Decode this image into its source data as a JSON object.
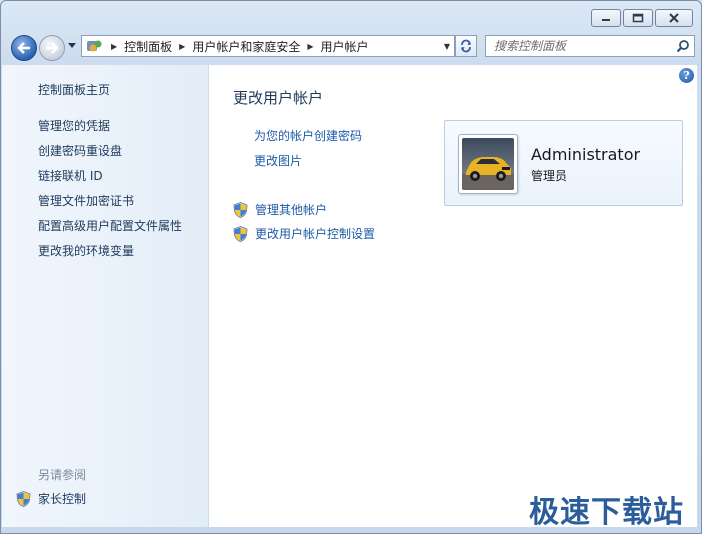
{
  "window": {
    "minimize_glyph": "—",
    "maximize_glyph": "▢",
    "close_glyph": "✕"
  },
  "toolbar": {
    "breadcrumb": [
      "控制面板",
      "用户帐户和家庭安全",
      "用户帐户"
    ],
    "search_placeholder": "搜索控制面板"
  },
  "sidebar": {
    "items": [
      {
        "label": "控制面板主页"
      },
      {
        "label": "管理您的凭据"
      },
      {
        "label": "创建密码重设盘"
      },
      {
        "label": "链接联机 ID"
      },
      {
        "label": "管理文件加密证书"
      },
      {
        "label": "配置高级用户配置文件属性"
      },
      {
        "label": "更改我的环境变量"
      }
    ],
    "see_also_title": "另请参阅",
    "see_also_items": [
      {
        "label": "家长控制"
      }
    ]
  },
  "main": {
    "title": "更改用户帐户",
    "tasks": [
      {
        "label": "为您的帐户创建密码"
      },
      {
        "label": "更改图片"
      }
    ],
    "shield_tasks": [
      {
        "label": "管理其他帐户"
      },
      {
        "label": "更改用户帐户控制设置"
      }
    ],
    "help_glyph": "?"
  },
  "account": {
    "name": "Administrator",
    "role": "管理员"
  },
  "watermark": "极速下载站",
  "colors": {
    "link": "#1f5aa8",
    "heading": "#1e395b",
    "accent": "#2c62b0"
  }
}
